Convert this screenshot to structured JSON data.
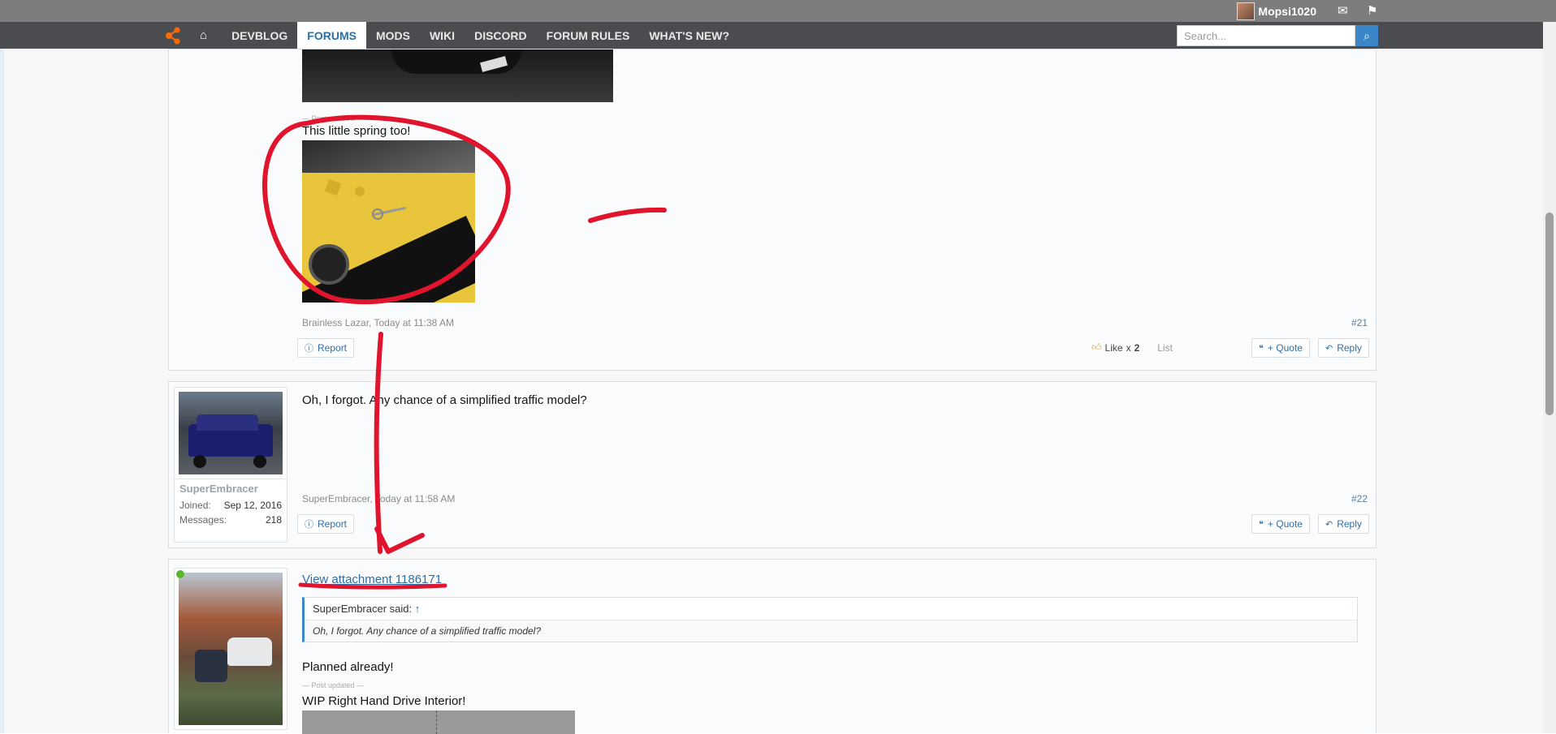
{
  "topbar": {
    "username": "Mopsi1020",
    "mail_icon": "envelope-icon",
    "alerts_icon": "flag-icon"
  },
  "nav": {
    "items": [
      "DEVBLOG",
      "FORUMS",
      "MODS",
      "WIKI",
      "DISCORD",
      "FORUM RULES",
      "WHAT'S NEW?"
    ],
    "active": "FORUMS",
    "search_placeholder": "Search..."
  },
  "post21": {
    "pinned_marker": "— Post updated —",
    "text": "This little spring too!",
    "meta": "Brainless Lazar, Today at 11:38 AM",
    "number": "#21",
    "report": "Report",
    "like_label": "Like",
    "like_count": "2",
    "like_prefix": "x",
    "list_label": "List",
    "quote": "+ Quote",
    "reply": "Reply"
  },
  "post22": {
    "username": "SuperEmbracer",
    "joined_label": "Joined:",
    "joined_value": "Sep 12, 2016",
    "messages_label": "Messages:",
    "messages_value": "218",
    "text": "Oh, I forgot. Any chance of a simplified traffic model?",
    "meta": "SuperEmbracer, Today at 11:58 AM",
    "number": "#22",
    "report": "Report",
    "quote": "+ Quote",
    "reply": "Reply"
  },
  "post23": {
    "attachment_link": "View attachment 1186171",
    "quote_author": "SuperEmbracer said:",
    "quote_arrow": "↑",
    "quote_text": "Oh, I forgot. Any chance of a simplified traffic model?",
    "text": "Planned already!",
    "pinned_marker": "— Post updated —",
    "text2": "WIP Right Hand Drive Interior!"
  },
  "colors": {
    "accent": "#3a86c8",
    "annotation": "#e0142c",
    "nav_bg": "#4a4c4f"
  }
}
